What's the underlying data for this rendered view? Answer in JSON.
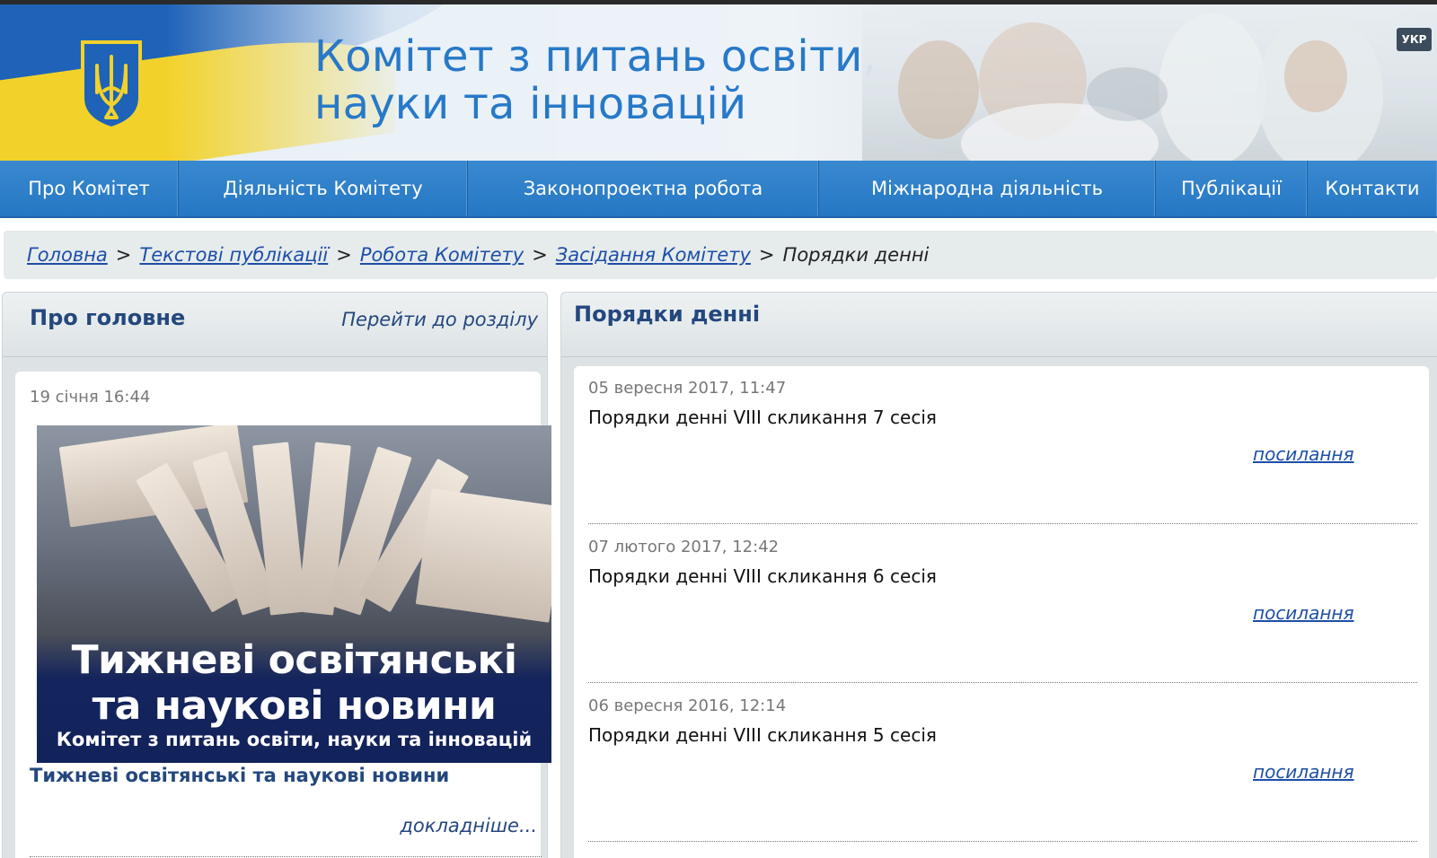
{
  "header": {
    "title_line1": "Комітет з питань освіти,",
    "title_line2": "науки та інновацій",
    "lang_button": "УКР"
  },
  "nav": {
    "items": [
      {
        "label": "Про Комітет"
      },
      {
        "label": "Діяльність Комітету"
      },
      {
        "label": "Законопроектна робота"
      },
      {
        "label": "Міжнародна діяльність"
      },
      {
        "label": "Публікації"
      },
      {
        "label": "Контакти"
      }
    ]
  },
  "breadcrumb": {
    "items": [
      "Головна",
      "Текстові публікації",
      "Робота Комітету",
      "Засідання Комітету"
    ],
    "current": "Порядки денні",
    "separator": ">"
  },
  "left_panel": {
    "title": "Про головне",
    "section_link": "Перейти до розділу",
    "news": {
      "date": "19 січня 16:44",
      "image_line1": "Тижневі освітянські",
      "image_line2": "та наукові новини",
      "image_line3": "Комітет з питань освіти, науки та інновацій",
      "title": "Тижневі освітянські та наукові новини",
      "more": "докладніше..."
    }
  },
  "right_panel": {
    "title": "Порядки денні",
    "entries": [
      {
        "date": "05 вересня 2017, 11:47",
        "title": "Порядки денні VIII скликання 7 сесія",
        "link": "посилання"
      },
      {
        "date": "07 лютого 2017, 12:42",
        "title": "Порядки денні VIII скликання 6 сесія",
        "link": "посилання"
      },
      {
        "date": "06 вересня 2016, 12:14",
        "title": "Порядки денні VIII скликання 5 сесія",
        "link": "посилання"
      }
    ]
  },
  "colors": {
    "nav_blue": "#2577c3",
    "title_blue": "#2779c8",
    "heading_navy": "#24477e",
    "link_blue": "#1d4fa8",
    "flag_yellow": "#f2d22a"
  }
}
